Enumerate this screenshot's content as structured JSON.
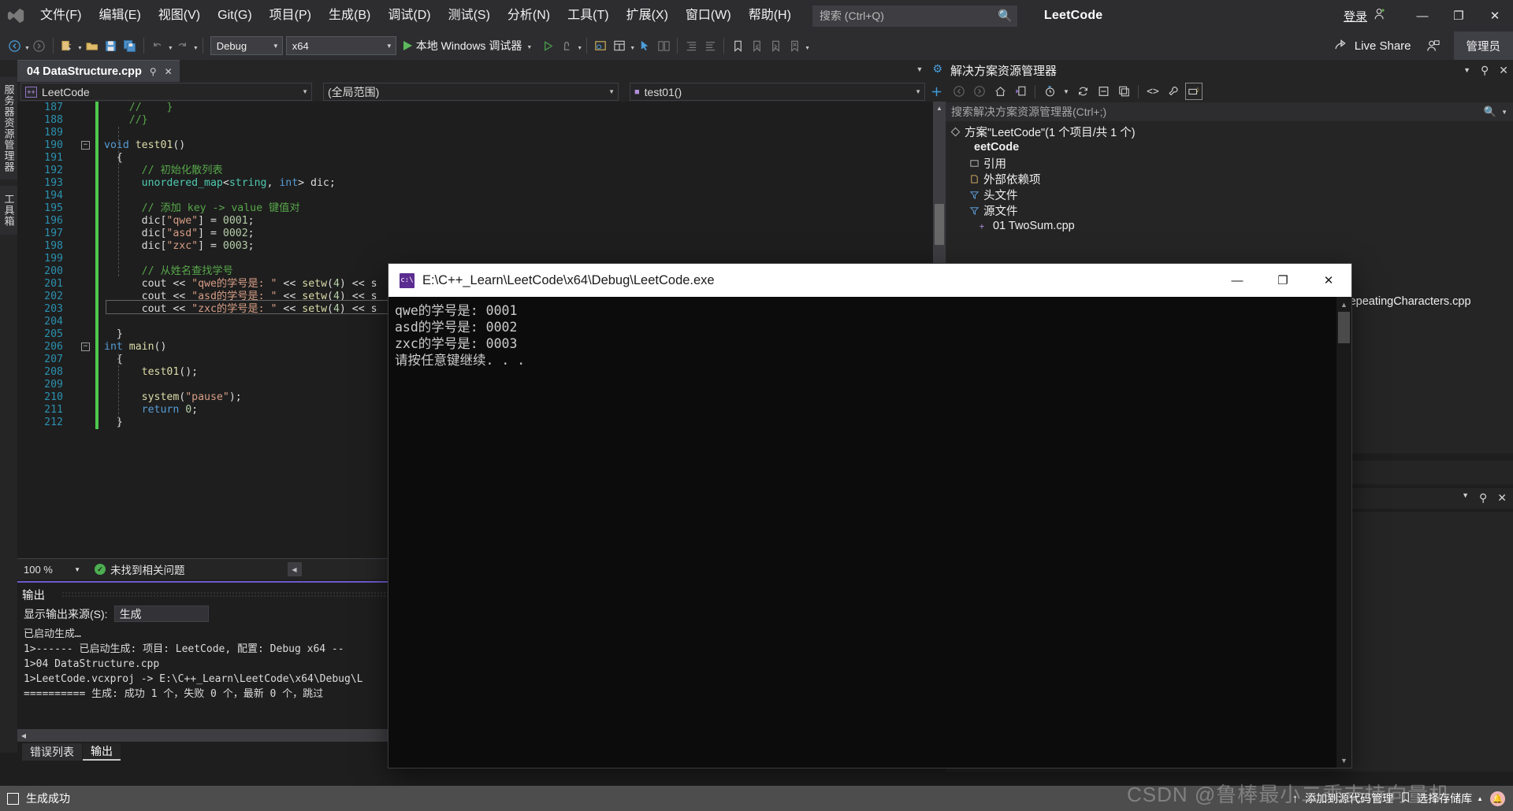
{
  "titlebar": {
    "logo_icon": "visual-studio-logo",
    "menus": [
      "文件(F)",
      "编辑(E)",
      "视图(V)",
      "Git(G)",
      "项目(P)",
      "生成(B)",
      "调试(D)",
      "测试(S)",
      "分析(N)",
      "工具(T)",
      "扩展(X)",
      "窗口(W)",
      "帮助(H)"
    ],
    "search_placeholder": "搜索 (Ctrl+Q)",
    "search_icon": "search-icon",
    "project_title": "LeetCode",
    "signin_label": "登录",
    "signin_icon": "add-user-icon",
    "minimize": "—",
    "maximize": "❐",
    "close": "✕"
  },
  "toolbar": {
    "config_value": "Debug",
    "platform_value": "x64",
    "run_label": "本地 Windows 调试器",
    "liveshare_label": "Live Share",
    "liveshare_icon": "share-icon",
    "admin_label": "管理员",
    "back_icon": "back-arrow-icon",
    "forward_icon": "forward-arrow-icon",
    "new_item_icon": "new-item-icon",
    "open_icon": "open-folder-icon",
    "save_icon": "save-icon",
    "save_all_icon": "save-all-icon",
    "undo_icon": "undo-icon",
    "redo_icon": "redo-icon"
  },
  "vertical_tabs": [
    "服务器资源管理器",
    "工具箱"
  ],
  "editor": {
    "tab_name": "04 DataStructure.cpp",
    "tab_pin_icon": "pin-icon",
    "tab_close_icon": "close-icon",
    "project_scope": "LeetCode",
    "scope_icon": "cpp-project-icon",
    "member_scope": "(全局范围)",
    "function_scope": "test01()",
    "function_icon": "method-icon",
    "zoom_level": "100 %",
    "issues_status": "未找到相关问题",
    "issues_icon": "green-check-icon",
    "first_line_number": 187,
    "lines": [
      {
        "n": 187,
        "indent": 0,
        "tokens": [
          {
            "t": "    //    }",
            "c": "k-cmt"
          }
        ]
      },
      {
        "n": 188,
        "indent": 0,
        "tokens": [
          {
            "t": "    //}",
            "c": "k-cmt"
          }
        ]
      },
      {
        "n": 189,
        "indent": 0,
        "tokens": []
      },
      {
        "n": 190,
        "fold": true,
        "tokens": [
          {
            "t": "void ",
            "c": "k-key"
          },
          {
            "t": "test01",
            "c": "k-fn"
          },
          {
            "t": "()",
            "c": "k-punct"
          }
        ]
      },
      {
        "n": 191,
        "tokens": [
          {
            "t": "  {",
            "c": "k-punct"
          }
        ]
      },
      {
        "n": 192,
        "tokens": [
          {
            "t": "      // 初始化散列表",
            "c": "k-cmt"
          }
        ]
      },
      {
        "n": 193,
        "tokens": [
          {
            "t": "      unordered_map",
            "c": "k-type"
          },
          {
            "t": "<",
            "c": "k-punct"
          },
          {
            "t": "string",
            "c": "k-type"
          },
          {
            "t": ", ",
            "c": "k-punct"
          },
          {
            "t": "int",
            "c": "k-key"
          },
          {
            "t": "> dic;",
            "c": "k-punct"
          }
        ]
      },
      {
        "n": 194,
        "tokens": []
      },
      {
        "n": 195,
        "tokens": [
          {
            "t": "      // 添加 key -> value 键值对",
            "c": "k-cmt"
          }
        ]
      },
      {
        "n": 196,
        "tokens": [
          {
            "t": "      dic[",
            "c": "k-txt"
          },
          {
            "t": "\"qwe\"",
            "c": "k-str"
          },
          {
            "t": "] = ",
            "c": "k-txt"
          },
          {
            "t": "0001",
            "c": "k-num"
          },
          {
            "t": ";",
            "c": "k-txt"
          }
        ]
      },
      {
        "n": 197,
        "tokens": [
          {
            "t": "      dic[",
            "c": "k-txt"
          },
          {
            "t": "\"asd\"",
            "c": "k-str"
          },
          {
            "t": "] = ",
            "c": "k-txt"
          },
          {
            "t": "0002",
            "c": "k-num"
          },
          {
            "t": ";",
            "c": "k-txt"
          }
        ]
      },
      {
        "n": 198,
        "tokens": [
          {
            "t": "      dic[",
            "c": "k-txt"
          },
          {
            "t": "\"zxc\"",
            "c": "k-str"
          },
          {
            "t": "] = ",
            "c": "k-txt"
          },
          {
            "t": "0003",
            "c": "k-num"
          },
          {
            "t": ";",
            "c": "k-txt"
          }
        ]
      },
      {
        "n": 199,
        "tokens": []
      },
      {
        "n": 200,
        "tokens": [
          {
            "t": "      // 从姓名查找学号",
            "c": "k-cmt"
          }
        ]
      },
      {
        "n": 201,
        "tokens": [
          {
            "t": "      cout << ",
            "c": "k-txt"
          },
          {
            "t": "\"qwe的学号是: \"",
            "c": "k-str"
          },
          {
            "t": " << ",
            "c": "k-txt"
          },
          {
            "t": "setw",
            "c": "k-fn"
          },
          {
            "t": "(",
            "c": "k-txt"
          },
          {
            "t": "4",
            "c": "k-num"
          },
          {
            "t": ") << s",
            "c": "k-txt"
          }
        ]
      },
      {
        "n": 202,
        "tokens": [
          {
            "t": "      cout << ",
            "c": "k-txt"
          },
          {
            "t": "\"asd的学号是: \"",
            "c": "k-str"
          },
          {
            "t": " << ",
            "c": "k-txt"
          },
          {
            "t": "setw",
            "c": "k-fn"
          },
          {
            "t": "(",
            "c": "k-txt"
          },
          {
            "t": "4",
            "c": "k-num"
          },
          {
            "t": ") << s",
            "c": "k-txt"
          }
        ]
      },
      {
        "n": 203,
        "tokens": [
          {
            "t": "      cout << ",
            "c": "k-txt"
          },
          {
            "t": "\"zxc的学号是: \"",
            "c": "k-str"
          },
          {
            "t": " << ",
            "c": "k-txt"
          },
          {
            "t": "setw",
            "c": "k-fn"
          },
          {
            "t": "(",
            "c": "k-txt"
          },
          {
            "t": "4",
            "c": "k-num"
          },
          {
            "t": ") << s",
            "c": "k-txt"
          }
        ]
      },
      {
        "n": 204,
        "tokens": []
      },
      {
        "n": 205,
        "tokens": [
          {
            "t": "  }",
            "c": "k-punct"
          }
        ]
      },
      {
        "n": 206,
        "fold": true,
        "tokens": [
          {
            "t": "int ",
            "c": "k-key"
          },
          {
            "t": "main",
            "c": "k-fn"
          },
          {
            "t": "()",
            "c": "k-punct"
          }
        ]
      },
      {
        "n": 207,
        "tokens": [
          {
            "t": "  {",
            "c": "k-punct"
          }
        ]
      },
      {
        "n": 208,
        "tokens": [
          {
            "t": "      test01",
            "c": "k-fn"
          },
          {
            "t": "();",
            "c": "k-txt"
          }
        ]
      },
      {
        "n": 209,
        "tokens": []
      },
      {
        "n": 210,
        "tokens": [
          {
            "t": "      system",
            "c": "k-fn"
          },
          {
            "t": "(",
            "c": "k-txt"
          },
          {
            "t": "\"pause\"",
            "c": "k-str"
          },
          {
            "t": ");",
            "c": "k-txt"
          }
        ]
      },
      {
        "n": 211,
        "tokens": [
          {
            "t": "      return ",
            "c": "k-key"
          },
          {
            "t": "0",
            "c": "k-num"
          },
          {
            "t": ";",
            "c": "k-txt"
          }
        ]
      },
      {
        "n": 212,
        "tokens": [
          {
            "t": "  }",
            "c": "k-punct"
          }
        ]
      }
    ]
  },
  "output_panel": {
    "title": "输出",
    "source_label": "显示输出来源(S):",
    "source_value": "生成",
    "lines": [
      "已启动生成…",
      "1>------ 已启动生成: 项目: LeetCode, 配置: Debug x64 --",
      "1>04 DataStructure.cpp",
      "1>LeetCode.vcxproj -> E:\\C++_Learn\\LeetCode\\x64\\Debug\\L",
      "========== 生成: 成功 1 个，失败 0 个，最新 0 个，跳过"
    ],
    "tabs": [
      {
        "label": "错误列表",
        "active": false
      },
      {
        "label": "输出",
        "active": true
      }
    ]
  },
  "solution_explorer": {
    "title": "解决方案资源管理器",
    "dropdown_icon": "chevron-down-icon",
    "pin_icon": "pin-icon",
    "close_icon": "close-icon",
    "toolbar_icons": [
      "back-arrow-icon",
      "forward-arrow-icon",
      "home-icon",
      "sync-with-editor-icon",
      "pending-changes-icon",
      "refresh-icon",
      "collapse-all-icon",
      "show-all-files-icon",
      "code-view-icon",
      "properties-icon",
      "preview-icon"
    ],
    "search_placeholder": "搜索解决方案资源管理器(Ctrl+;)",
    "search_icon": "search-icon",
    "tree": [
      {
        "label": "方案\"LeetCode\"(1 个项目/共 1 个)",
        "indent": 0,
        "icon": "solution-icon",
        "bold": false
      },
      {
        "label": "eetCode",
        "indent": 1,
        "icon": "project-icon",
        "bold": true
      },
      {
        "label": "引用",
        "indent": 2,
        "icon": "references-icon",
        "bold": false
      },
      {
        "label": "外部依赖项",
        "indent": 2,
        "icon": "external-deps-icon",
        "bold": false
      },
      {
        "label": "头文件",
        "indent": 2,
        "icon": "filter-folder-icon",
        "bold": false
      },
      {
        "label": "源文件",
        "indent": 2,
        "icon": "filter-folder-icon",
        "bold": false
      },
      {
        "label": "01 TwoSum.cpp",
        "indent": 3,
        "icon": "cpp-file-icon",
        "bold": false
      }
    ],
    "hidden_file": "utRepeatingCharacters.cpp"
  },
  "console_window": {
    "icon": "console-app-icon",
    "title": "E:\\C++_Learn\\LeetCode\\x64\\Debug\\LeetCode.exe",
    "minimize": "—",
    "maximize": "❐",
    "close": "✕",
    "output": [
      "qwe的学号是: 0001",
      "asd的学号是: 0002",
      "zxc的学号是: 0003",
      "请按任意键继续. . ."
    ]
  },
  "statusbar": {
    "icon": "ready-icon",
    "status": "生成成功",
    "up_arrow_icon": "up-arrow-icon",
    "source_control_label": "添加到源代码管理",
    "repo_icon": "repository-icon",
    "repo_label": "选择存储库",
    "repo_caret": "chevron-up-icon",
    "notification_icon": "bell-icon"
  },
  "watermark": "CSDN @鲁棒最小二乘支持向量机",
  "colors": {
    "accent_blue": "#007acc",
    "status_bar": "#4d4d4d",
    "chrome": "#2d2d30",
    "panel": "#252526",
    "editor_bg": "#1e1e1e",
    "comment_green": "#57a64a",
    "string_orange": "#d69d85",
    "keyword_blue": "#569cd6",
    "number_green": "#b5cea8",
    "line_number": "#2b91af",
    "changed_line": "#4ec94e"
  }
}
